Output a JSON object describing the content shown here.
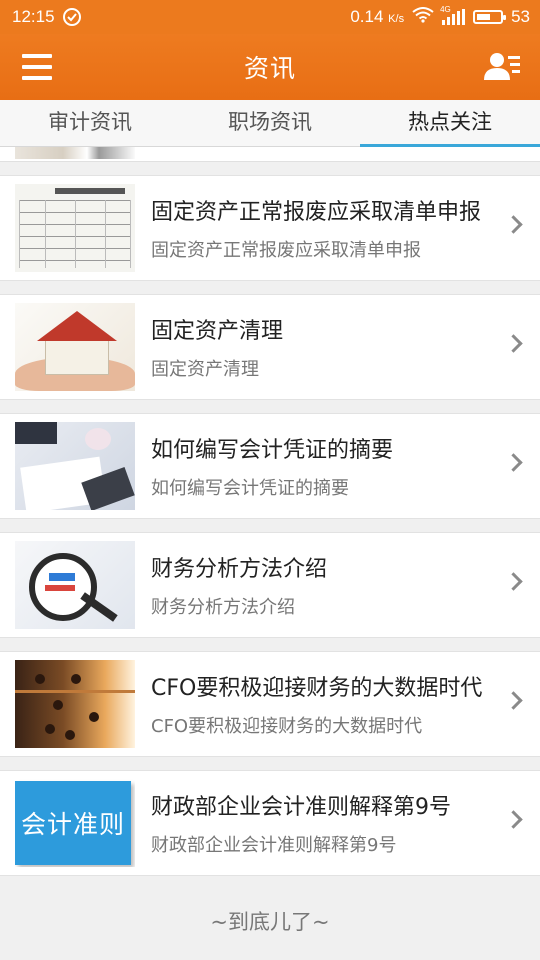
{
  "status_bar": {
    "time": "12:15",
    "speed": "0.14",
    "speed_unit": "K/s",
    "network": "4G",
    "battery": "53"
  },
  "app_bar": {
    "title": "资讯",
    "menu_icon": "hamburger-menu-icon",
    "user_icon": "user-list-icon"
  },
  "tabs": [
    {
      "label": "审计资讯",
      "active": false
    },
    {
      "label": "职场资讯",
      "active": false
    },
    {
      "label": "热点关注",
      "active": true
    }
  ],
  "colors": {
    "header": "#ec7a1e",
    "tab_indicator": "#3aa7d9",
    "thumb_kuaiji": "#2d9bdc"
  },
  "items": [
    {
      "title": "固定资产正常报废应采取清单申报",
      "subtitle": "固定资产正常报废应采取清单申报",
      "image": "form-document"
    },
    {
      "title": "固定资产清理",
      "subtitle": "固定资产清理",
      "image": "house-in-hands"
    },
    {
      "title": "如何编写会计凭证的摘要",
      "subtitle": "如何编写会计凭证的摘要",
      "image": "writing-calculator"
    },
    {
      "title": "财务分析方法介绍",
      "subtitle": "财务分析方法介绍",
      "image": "magnifier-chart"
    },
    {
      "title": "CFO要积极迎接财务的大数据时代",
      "subtitle": "CFO要积极迎接财务的大数据时代",
      "image": "abacus"
    },
    {
      "title": "财政部企业会计准则解释第9号",
      "subtitle": "财政部企业会计准则解释第9号",
      "image": "kuaiji-zhunze-sign",
      "image_text": "会计准则"
    }
  ],
  "footer": "~到底儿了~"
}
